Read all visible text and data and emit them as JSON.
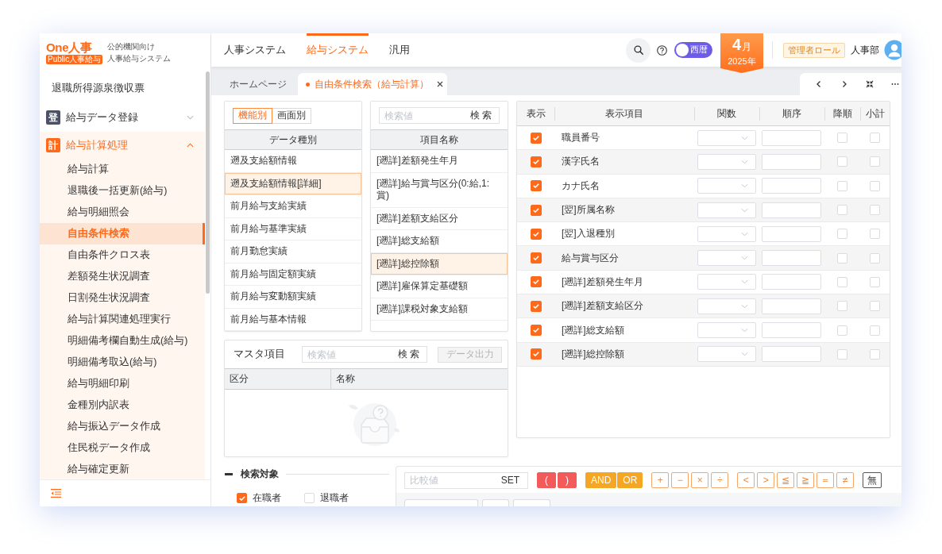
{
  "sidebar": {
    "logo": {
      "name": "One人事",
      "tag": "Public人事給与",
      "subtitle_1": "公的機関向け",
      "subtitle_2": "人事給与システム"
    },
    "items": [
      {
        "kind": "leaf",
        "label": "退職所得源泉徴収票",
        "selected": false
      },
      {
        "kind": "group",
        "badge": "登",
        "label": "給与データ登録",
        "selected": false,
        "expanded": false
      },
      {
        "kind": "group",
        "badge": "計",
        "label": "給与計算処理",
        "selected": true,
        "expanded": true,
        "children": [
          {
            "label": "給与計算",
            "selected": false
          },
          {
            "label": "退職後一括更新(給与)",
            "selected": false
          },
          {
            "label": "給与明細照会",
            "selected": false
          },
          {
            "label": "自由条件検索",
            "selected": true
          },
          {
            "label": "自由条件クロス表",
            "selected": false
          },
          {
            "label": "差額発生状況調査",
            "selected": false
          },
          {
            "label": "日割発生状況調査",
            "selected": false
          },
          {
            "label": "給与計算関連処理実行",
            "selected": false
          },
          {
            "label": "明細備考欄自動生成(給与)",
            "selected": false
          },
          {
            "label": "明細備考取込(給与)",
            "selected": false
          },
          {
            "label": "給与明細印刷",
            "selected": false
          },
          {
            "label": "金種別内訳表",
            "selected": false
          },
          {
            "label": "給与振込データ作成",
            "selected": false
          },
          {
            "label": "住民税データ作成",
            "selected": false
          },
          {
            "label": "給与確定更新",
            "selected": false
          }
        ]
      }
    ]
  },
  "top_nav": {
    "tabs": [
      {
        "label": "人事システム",
        "selected": false
      },
      {
        "label": "給与システム",
        "selected": true
      },
      {
        "label": "汎用",
        "selected": false
      }
    ],
    "calendar_toggle": {
      "label": "西暦"
    },
    "period": {
      "month": "4",
      "month_unit": "月",
      "year": "2025年"
    },
    "role": "管理者ロール",
    "user": "人事部"
  },
  "page_tabs": [
    {
      "label": "ホームページ",
      "selected": false,
      "closable": false
    },
    {
      "label": "自由条件検索（給与計算）",
      "selected": true,
      "closable": true
    }
  ],
  "data_type_panel": {
    "mode_tabs": [
      {
        "label": "機能別",
        "selected": true
      },
      {
        "label": "画面別",
        "selected": false
      }
    ],
    "header": "データ種別",
    "rows": [
      {
        "label": "遡及支給額情報",
        "selected": false
      },
      {
        "label": "遡及支給額情報[詳細]",
        "selected": true
      },
      {
        "label": "前月給与支給実績",
        "selected": false
      },
      {
        "label": "前月給与基準実績",
        "selected": false
      },
      {
        "label": "前月勤怠実績",
        "selected": false
      },
      {
        "label": "前月給与固定額実績",
        "selected": false
      },
      {
        "label": "前月給与変動額実績",
        "selected": false
      },
      {
        "label": "前月給与基本情報",
        "selected": false
      }
    ]
  },
  "item_panel": {
    "search": {
      "placeholder": "検索値",
      "button": "検 索"
    },
    "header": "項目名称",
    "rows": [
      {
        "label": "[遡詳]差額発生年月",
        "selected": false
      },
      {
        "label": "[遡詳]給与賞与区分(0:給,1:賞)",
        "selected": false
      },
      {
        "label": "[遡詳]差額支給区分",
        "selected": false
      },
      {
        "label": "[遡詳]総支給額",
        "selected": false
      },
      {
        "label": "[遡詳]総控除額",
        "selected": true
      },
      {
        "label": "[遡詳]雇保算定基礎額",
        "selected": false
      },
      {
        "label": "[遡詳]課税対象支給額",
        "selected": false
      }
    ]
  },
  "master_panel": {
    "title": "マスタ項目",
    "search": {
      "placeholder": "検索値",
      "button": "検 索"
    },
    "export_button": {
      "label": "データ出力",
      "disabled": true
    },
    "columns": [
      "区分",
      "名称"
    ]
  },
  "display_table": {
    "columns": [
      "表示",
      "表示項目",
      "関数",
      "順序",
      "降順",
      "小計"
    ],
    "rows": [
      {
        "label": "職員番号",
        "shown": true,
        "descending": false,
        "subtotal": false
      },
      {
        "label": "漢字氏名",
        "shown": true,
        "descending": false,
        "subtotal": false
      },
      {
        "label": "カナ氏名",
        "shown": true,
        "descending": false,
        "subtotal": false
      },
      {
        "label": "[翌]所属名称",
        "shown": true,
        "descending": false,
        "subtotal": false
      },
      {
        "label": "[翌]入退種別",
        "shown": true,
        "descending": false,
        "subtotal": false
      },
      {
        "label": "給与賞与区分",
        "shown": true,
        "descending": false,
        "subtotal": false
      },
      {
        "label": "[遡詳]差額発生年月",
        "shown": true,
        "descending": false,
        "subtotal": false
      },
      {
        "label": "[遡詳]差額支給区分",
        "shown": true,
        "descending": false,
        "subtotal": false
      },
      {
        "label": "[遡詳]総支給額",
        "shown": true,
        "descending": false,
        "subtotal": false
      },
      {
        "label": "[遡詳]総控除額",
        "shown": true,
        "descending": false,
        "subtotal": false
      }
    ]
  },
  "search_target": {
    "title": "検索対象",
    "expanded": true,
    "options": [
      {
        "label": "在職者",
        "checked": true
      },
      {
        "label": "退職者",
        "checked": false
      }
    ]
  },
  "condition_builder": {
    "compare_field": {
      "placeholder": "比較値",
      "button": "SET"
    },
    "operator_groups": [
      {
        "kind": "paren",
        "buttons": [
          "(",
          ")"
        ]
      },
      {
        "kind": "logic",
        "buttons": [
          "AND",
          "OR"
        ]
      },
      {
        "kind": "arith",
        "buttons": [
          "+",
          "−",
          "×",
          "÷"
        ]
      },
      {
        "kind": "compare",
        "buttons": [
          "<",
          ">",
          "≦",
          "≧",
          "＝",
          "≠"
        ]
      },
      {
        "kind": "plain",
        "buttons": [
          "無"
        ]
      }
    ],
    "expression": [
      {
        "kind": "field"
      },
      {
        "kind": "operator"
      },
      {
        "kind": "value"
      }
    ]
  }
}
